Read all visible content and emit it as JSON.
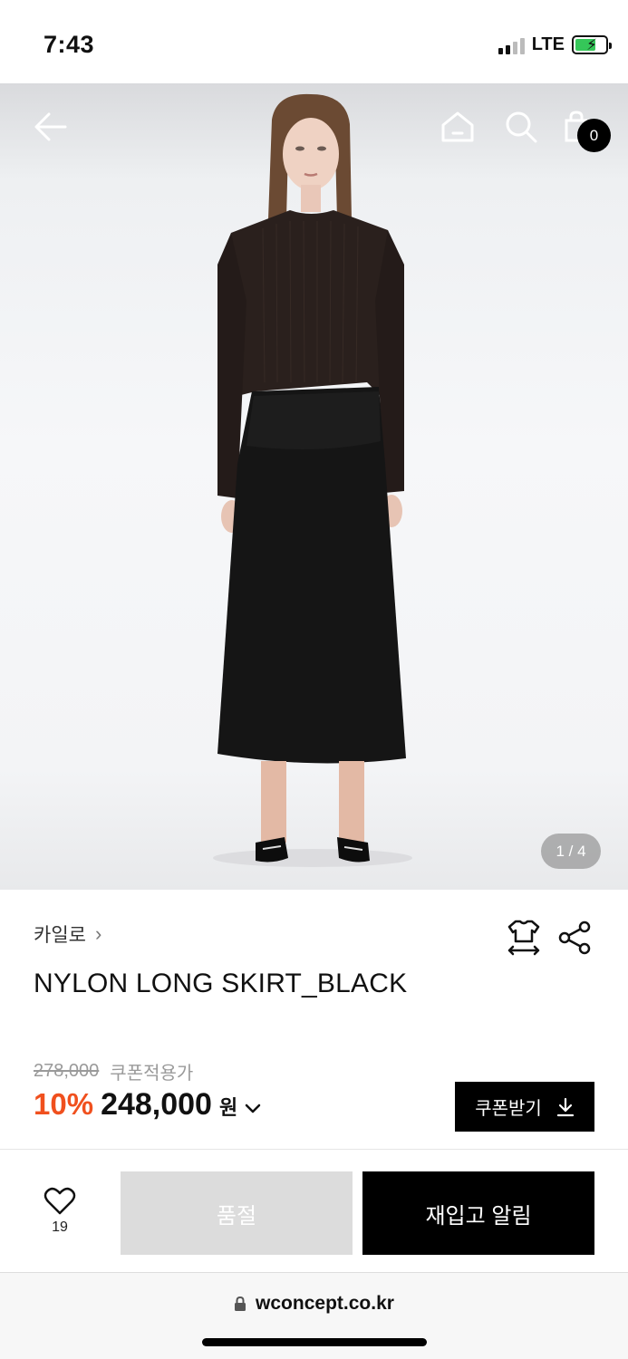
{
  "status_bar": {
    "time": "7:43",
    "network": "LTE"
  },
  "hero": {
    "cart_count": "0",
    "pager": "1 / 4",
    "icons": {
      "back": "arrow-left-icon",
      "home": "home-icon",
      "search": "search-icon",
      "cart": "shopping-bag-icon"
    }
  },
  "product": {
    "brand": "카일로",
    "brand_chevron": "›",
    "title": "NYLON LONG SKIRT_BLACK",
    "original_price": "278,000",
    "coupon_price_label": "쿠폰적용가",
    "discount": "10%",
    "sale_price": "248,000",
    "currency": "원",
    "price_chevron": "⌄",
    "coupon_button": "쿠폰받기",
    "icons": {
      "size": "size-guide-icon",
      "share": "share-icon",
      "coupon_download": "download-icon"
    }
  },
  "actions": {
    "wish_count": "19",
    "sold_out": "품절",
    "restock_alert": "재입고 알림"
  },
  "browser": {
    "url": "wconcept.co.kr"
  },
  "colors": {
    "accent": "#f0501e",
    "black": "#000000",
    "disabled": "#dcdcdc"
  }
}
